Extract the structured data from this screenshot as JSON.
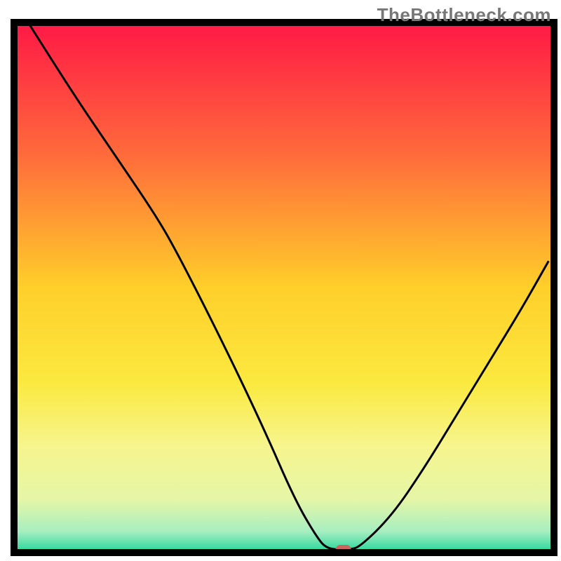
{
  "watermark": "TheBottleneck.com",
  "chart_data": {
    "type": "line",
    "title": "",
    "xlabel": "",
    "ylabel": "",
    "xlim": [
      0,
      100
    ],
    "ylim": [
      0,
      100
    ],
    "grid": false,
    "curve": [
      {
        "x": 2,
        "y": 101
      },
      {
        "x": 10,
        "y": 88
      },
      {
        "x": 18,
        "y": 76
      },
      {
        "x": 26,
        "y": 64
      },
      {
        "x": 30,
        "y": 57
      },
      {
        "x": 38,
        "y": 41
      },
      {
        "x": 46,
        "y": 24
      },
      {
        "x": 52,
        "y": 10
      },
      {
        "x": 56,
        "y": 3
      },
      {
        "x": 58,
        "y": 0.6
      },
      {
        "x": 62,
        "y": 0.6
      },
      {
        "x": 64,
        "y": 1.0
      },
      {
        "x": 70,
        "y": 7
      },
      {
        "x": 76,
        "y": 16
      },
      {
        "x": 82,
        "y": 26
      },
      {
        "x": 88,
        "y": 36
      },
      {
        "x": 94,
        "y": 46
      },
      {
        "x": 99,
        "y": 55
      }
    ],
    "marker": {
      "x": 61,
      "y": 0.6,
      "color": "#c9665e"
    },
    "background_gradient": [
      {
        "offset": 0,
        "color": "#ff1846"
      },
      {
        "offset": 0.25,
        "color": "#ff6b3b"
      },
      {
        "offset": 0.5,
        "color": "#ffcf2a"
      },
      {
        "offset": 0.68,
        "color": "#fbe93f"
      },
      {
        "offset": 0.8,
        "color": "#f6f58e"
      },
      {
        "offset": 0.9,
        "color": "#e5f6a7"
      },
      {
        "offset": 0.96,
        "color": "#a7eec0"
      },
      {
        "offset": 1.0,
        "color": "#22d69b"
      }
    ]
  }
}
